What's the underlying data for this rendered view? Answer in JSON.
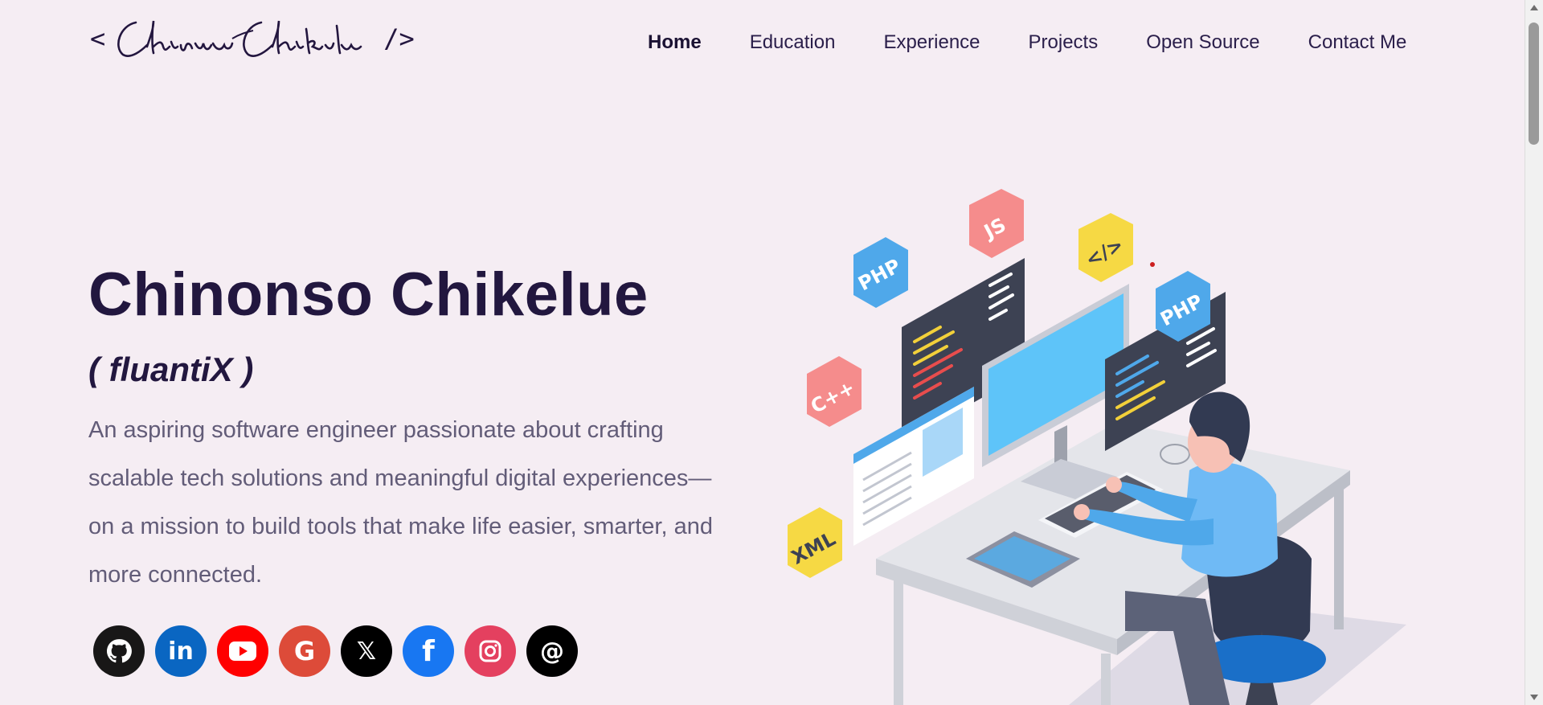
{
  "logo": {
    "open": "<",
    "name": "Chinonso Chikelue",
    "close": "/>"
  },
  "nav": {
    "items": [
      {
        "label": "Home",
        "active": true
      },
      {
        "label": "Education"
      },
      {
        "label": "Experience"
      },
      {
        "label": "Projects"
      },
      {
        "label": "Open Source"
      },
      {
        "label": "Contact Me"
      }
    ]
  },
  "hero": {
    "title": "Chinonso Chikelue",
    "alias": "( fluantiX )",
    "bio": "An aspiring software engineer passionate about crafting scalable tech solutions and meaningful digital experiences—on a mission to build tools that make life easier, smarter, and more connected."
  },
  "social": [
    {
      "name": "github-icon",
      "color": "#181717",
      "glyph": "GH"
    },
    {
      "name": "linkedin-icon",
      "color": "#0a66c2",
      "glyph": "in"
    },
    {
      "name": "youtube-icon",
      "color": "#ff0000",
      "glyph": "▶"
    },
    {
      "name": "google-icon",
      "color": "#dd4b39",
      "glyph": "G"
    },
    {
      "name": "x-icon",
      "color": "#000000",
      "glyph": "X"
    },
    {
      "name": "facebook-icon",
      "color": "#1877f2",
      "glyph": "f"
    },
    {
      "name": "instagram-icon",
      "color": "#e4405f",
      "glyph": "◎"
    },
    {
      "name": "threads-icon",
      "color": "#000000",
      "glyph": "@"
    }
  ],
  "illustration": {
    "badges": [
      "PHP",
      "JS",
      "</>",
      "PHP",
      "C++",
      "XML"
    ]
  },
  "colors": {
    "background": "#f5edf3",
    "heading": "#22173f",
    "body_text": "#625c78"
  }
}
